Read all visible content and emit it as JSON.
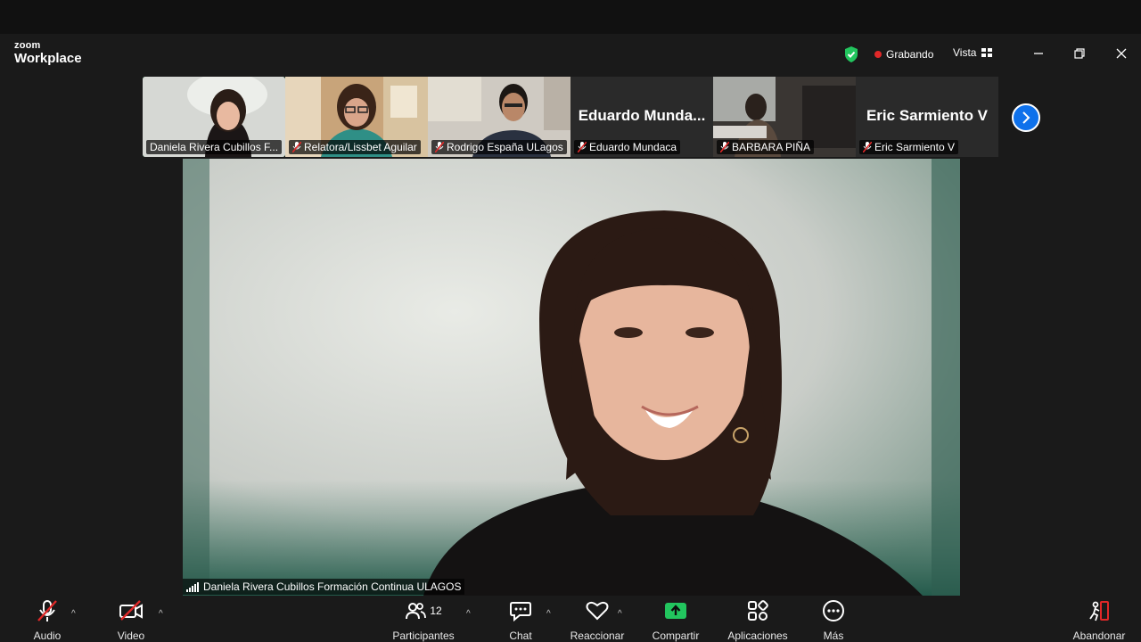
{
  "app": {
    "brand_small": "zoom",
    "brand_big": "Workplace"
  },
  "header": {
    "recording_label": "Grabando",
    "view_label": "Vista"
  },
  "thumbnails": [
    {
      "name": "Daniela Rivera Cubillos F...",
      "bigname": "",
      "muted": false,
      "active": true
    },
    {
      "name": "Relatora/Lissbet Aguilar",
      "bigname": "",
      "muted": true,
      "active": false
    },
    {
      "name": "Rodrigo España  ULagos",
      "bigname": "",
      "muted": true,
      "active": false
    },
    {
      "name": "Eduardo Mundaca",
      "bigname": "Eduardo  Munda...",
      "muted": true,
      "active": false
    },
    {
      "name": "BARBARA PIÑA",
      "bigname": "",
      "muted": true,
      "active": false
    },
    {
      "name": "Eric Sarmiento V",
      "bigname": "Eric Sarmiento V",
      "muted": true,
      "active": false
    }
  ],
  "main": {
    "speaker_label": "Daniela Rivera Cubillos Formación Continua ULAGOS"
  },
  "toolbar": {
    "audio": "Audio",
    "video": "Video",
    "participants": "Participantes",
    "participants_count": "12",
    "chat": "Chat",
    "react": "Reaccionar",
    "share": "Compartir",
    "apps": "Aplicaciones",
    "more": "Más",
    "leave": "Abandonar"
  },
  "colors": {
    "accent": "#0e71eb",
    "share_green": "#22c55e",
    "record_red": "#e02828",
    "muted_red": "#e02828"
  }
}
